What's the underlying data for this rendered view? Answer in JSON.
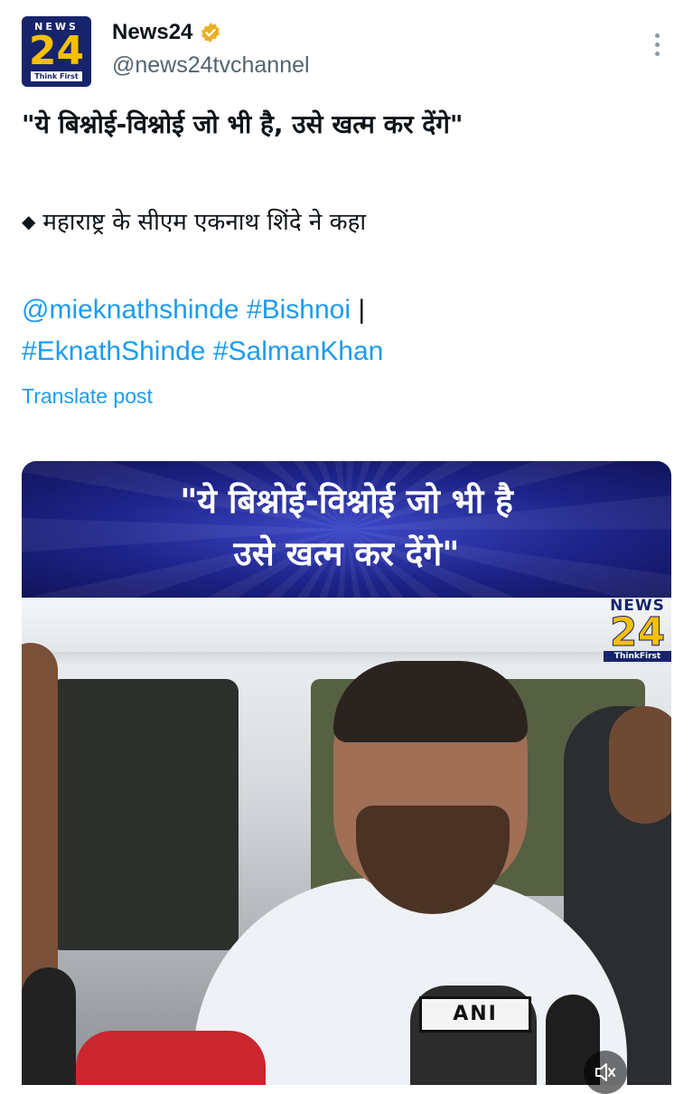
{
  "account": {
    "name": "News24",
    "handle": "@news24tvchannel",
    "avatar_top": "NEWS",
    "avatar_num": "24",
    "avatar_tag": "Think First",
    "verified_color": "#e8b022"
  },
  "post": {
    "quote": "\"ये बिश्नोई-विश्नोई जो भी है, उसे खत्म कर देंगे\"",
    "line2": "महाराष्ट्र के सीएम एकनाथ शिंदे ने कहा",
    "tags": {
      "mention": "@mieknathshinde",
      "tag1": "#Bishnoi",
      "separator": "|",
      "tag2": "#EknathShinde",
      "tag3": "#SalmanKhan"
    },
    "translate_label": "Translate post"
  },
  "media": {
    "banner_line1": "\"ये बिश्नोई-विश्नोई जो भी है",
    "banner_line2": "उसे खत्म कर देंगे\"",
    "logo_top": "NEWS",
    "logo_num": "24",
    "logo_tag": "ThinkFirst",
    "mic_label": "ANI",
    "accent": "#1d9bf0"
  }
}
